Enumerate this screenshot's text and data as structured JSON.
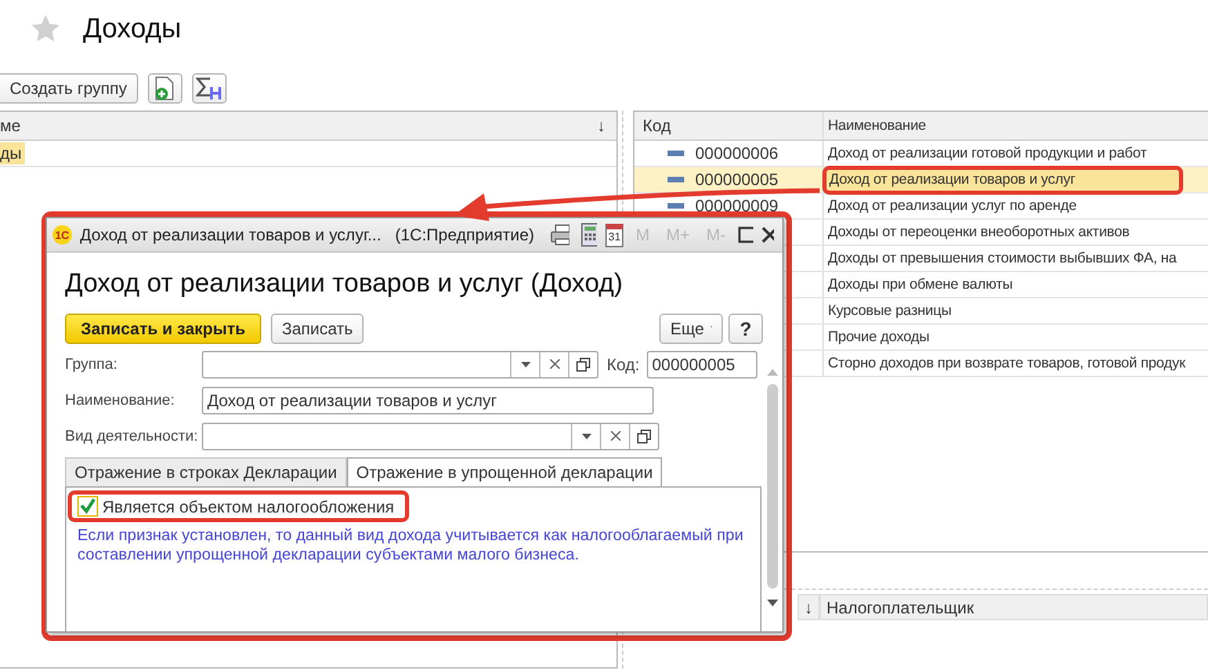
{
  "page": {
    "title": "Доходы"
  },
  "toolbar": {
    "create_group": "Создать группу"
  },
  "groups_table": {
    "columns": [
      "ме",
      "↓"
    ],
    "rows": [
      {
        "name": "ды",
        "selected": true
      }
    ]
  },
  "items_table": {
    "columns": [
      "Код",
      "Наименование"
    ],
    "rows": [
      {
        "code": "000000006",
        "name": "Доход от реализации готовой продукции и работ",
        "selected": false
      },
      {
        "code": "000000005",
        "name": "Доход от реализации товаров и услуг",
        "selected": true
      },
      {
        "code": "000000009",
        "name": "Доход от реализации услуг по аренде",
        "selected": false
      },
      {
        "name": "Доходы от переоценки внеоборотных активов",
        "selected": false
      },
      {
        "name": "Доходы от превышения стоимости выбывших ФА, на",
        "selected": false
      },
      {
        "name": "Доходы при обмене валюты",
        "selected": false
      },
      {
        "name": "Курсовые разницы",
        "selected": false
      },
      {
        "name": "Прочие доходы",
        "selected": false
      },
      {
        "name": "Сторно доходов при возврате товаров, готовой продук",
        "selected": false
      }
    ]
  },
  "lower_table": {
    "columns": [
      "↓",
      "Налогоплательщик"
    ]
  },
  "dialog": {
    "logo": "1С",
    "title": "Доход от реализации товаров и услуг...",
    "app": "(1С:Предприятие)",
    "calendar_day": "31",
    "memory_buttons": [
      {
        "label": "M",
        "disabled": true
      },
      {
        "label": "M+",
        "disabled": true
      },
      {
        "label": "M-",
        "disabled": true
      }
    ],
    "heading": "Доход от реализации товаров и услуг (Доход)",
    "buttons": [
      {
        "label": "Записать и закрыть",
        "kind": "primary"
      },
      {
        "label": "Записать",
        "kind": "normal"
      }
    ],
    "more_button": "Еще",
    "help_button": "?",
    "group": {
      "label": "Группа:"
    },
    "code": {
      "label": "Код:",
      "value": "000000005"
    },
    "name": {
      "label": "Наименование:",
      "value": "Доход от реализации товаров и услуг"
    },
    "activity": {
      "label": "Вид деятельности:"
    },
    "tabs": [
      {
        "label": "Отражение в строках Декларации",
        "selected": false
      },
      {
        "label": "Отражение в упрощенной декларации",
        "selected": true
      }
    ],
    "checkbox": {
      "label": "Является объектом налогообложения",
      "checked": true
    },
    "hint": "Если признак установлен, то данный вид дохода учитывается как налогооблагаемый при составлении упрощенной декларации субъектами малого бизнеса."
  }
}
